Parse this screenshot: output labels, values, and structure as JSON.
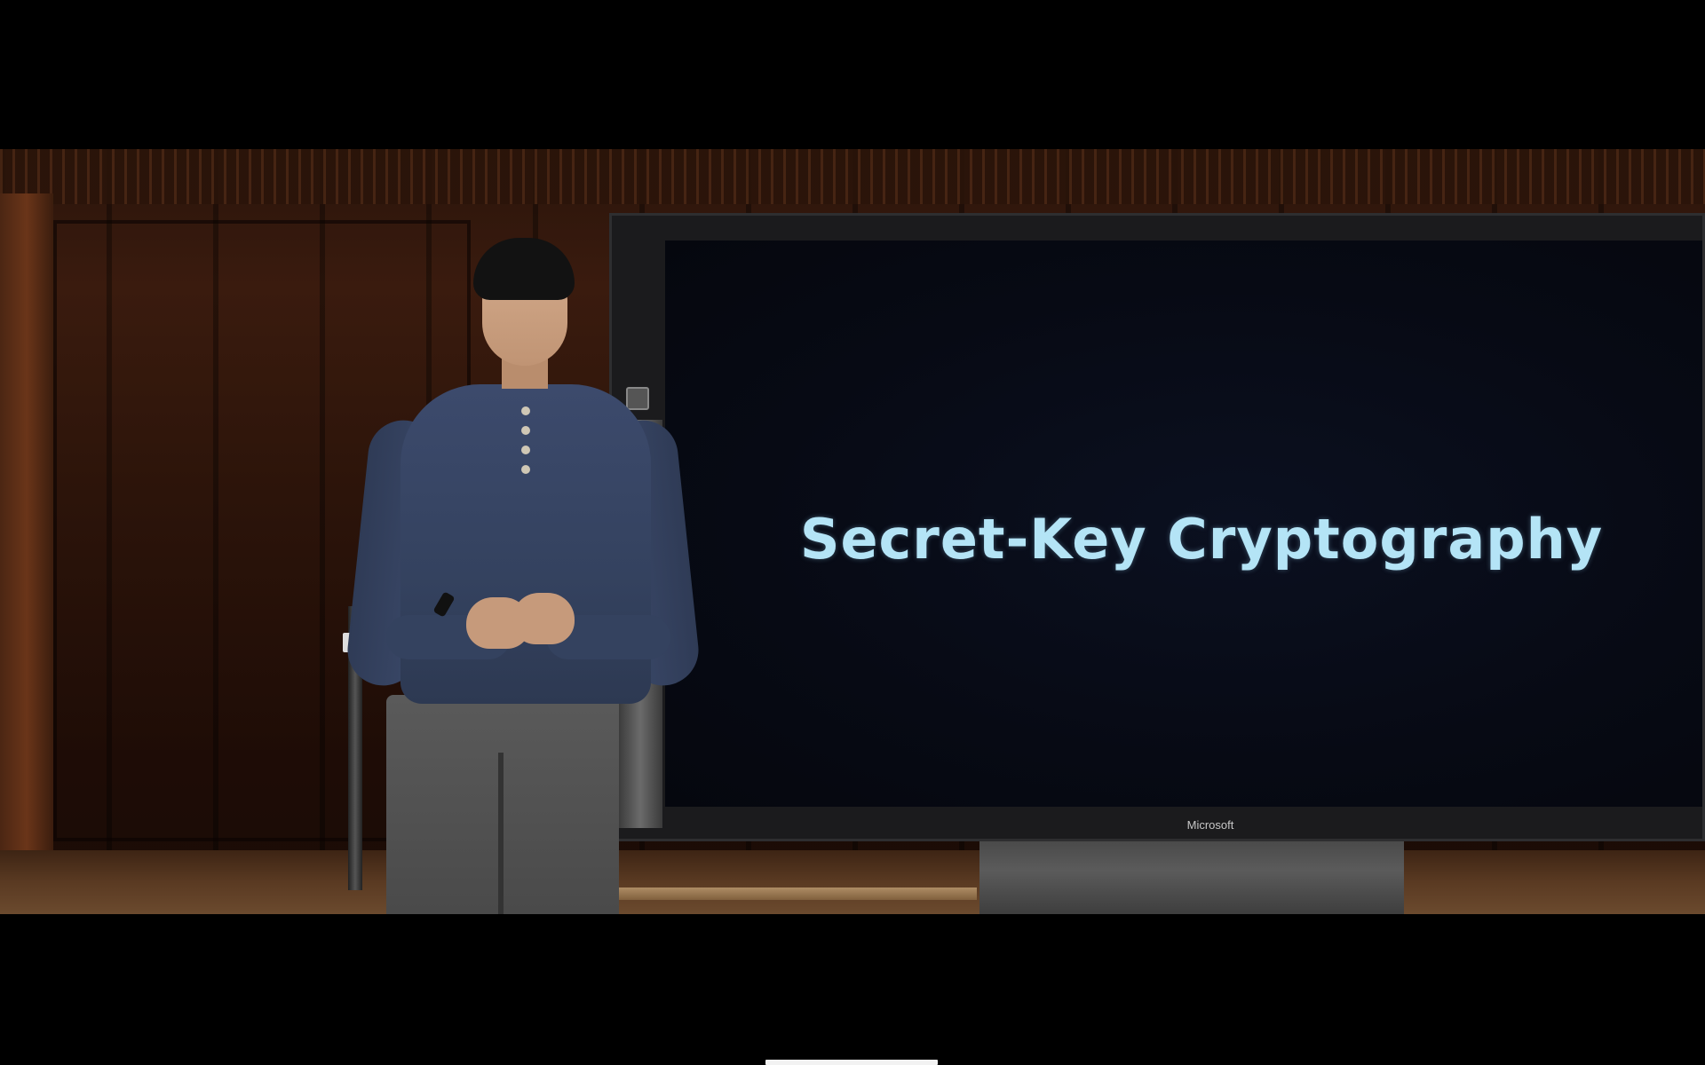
{
  "video": {
    "slide_title": "Secret-Key Cryptography",
    "display_brand": "Microsoft"
  },
  "colors": {
    "slide_title": "#b4e4f6",
    "letterbox": "#000000"
  }
}
